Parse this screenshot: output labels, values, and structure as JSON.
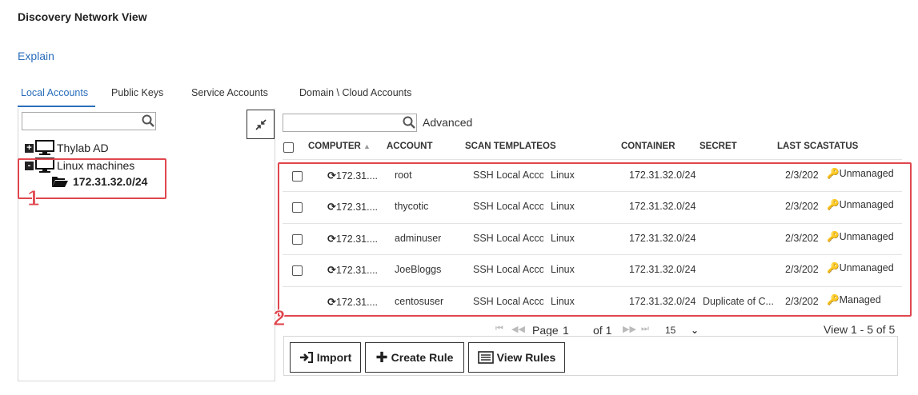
{
  "page": {
    "title": "Discovery Network View",
    "explain_link": "Explain"
  },
  "tabs": [
    {
      "label": "Local Accounts",
      "active": true
    },
    {
      "label": "Public Keys",
      "active": false
    },
    {
      "label": "Service Accounts",
      "active": false
    },
    {
      "label": "Domain \\ Cloud Accounts",
      "active": false
    }
  ],
  "tree": {
    "search_value": "",
    "nodes": [
      {
        "label": "Thylab AD",
        "toggle": "+",
        "icon": "computer-icon"
      },
      {
        "label": "Linux machines",
        "toggle": "-",
        "icon": "computer-icon"
      },
      {
        "label": "172.31.32.0/24",
        "icon": "folder-open-icon",
        "selected": true
      }
    ]
  },
  "grid": {
    "advanced_label": "Advanced",
    "columns": [
      "COMPUTER",
      "ACCOUNT",
      "SCAN TEMPLATE",
      "OS",
      "CONTAINER",
      "SECRET",
      "LAST SCAN",
      "STATUS"
    ],
    "rows": [
      {
        "computer": "172.31....",
        "account": "root",
        "scan_template": "SSH Local Acco",
        "os": "Linux",
        "container": "172.31.32.0/24",
        "secret": "",
        "last_scan": "2/3/202",
        "status": "Unmanaged",
        "checkbox": true
      },
      {
        "computer": "172.31....",
        "account": "thycotic",
        "scan_template": "SSH Local Acco",
        "os": "Linux",
        "container": "172.31.32.0/24",
        "secret": "",
        "last_scan": "2/3/202",
        "status": "Unmanaged",
        "checkbox": true
      },
      {
        "computer": "172.31....",
        "account": "adminuser",
        "scan_template": "SSH Local Acco",
        "os": "Linux",
        "container": "172.31.32.0/24",
        "secret": "",
        "last_scan": "2/3/202",
        "status": "Unmanaged",
        "checkbox": true
      },
      {
        "computer": "172.31....",
        "account": "JoeBloggs",
        "scan_template": "SSH Local Acco",
        "os": "Linux",
        "container": "172.31.32.0/24",
        "secret": "",
        "last_scan": "2/3/202",
        "status": "Unmanaged",
        "checkbox": true
      },
      {
        "computer": "172.31....",
        "account": "centosuser",
        "scan_template": "SSH Local Acco",
        "os": "Linux",
        "container": "172.31.32.0/24",
        "secret": "Duplicate of C...",
        "last_scan": "2/3/202",
        "status": "Managed",
        "checkbox": false
      }
    ]
  },
  "pager": {
    "page_label": "Page",
    "page_value": "1",
    "of_label": "of 1",
    "page_size": "15",
    "view_text": "View 1 - 5 of 5"
  },
  "buttons": {
    "import": "Import",
    "create_rule": "Create Rule",
    "view_rules": "View Rules"
  },
  "annotations": {
    "one": "1",
    "two": "2"
  },
  "colors": {
    "accent": "#2a6ebb",
    "annotation": "#e0464e"
  }
}
